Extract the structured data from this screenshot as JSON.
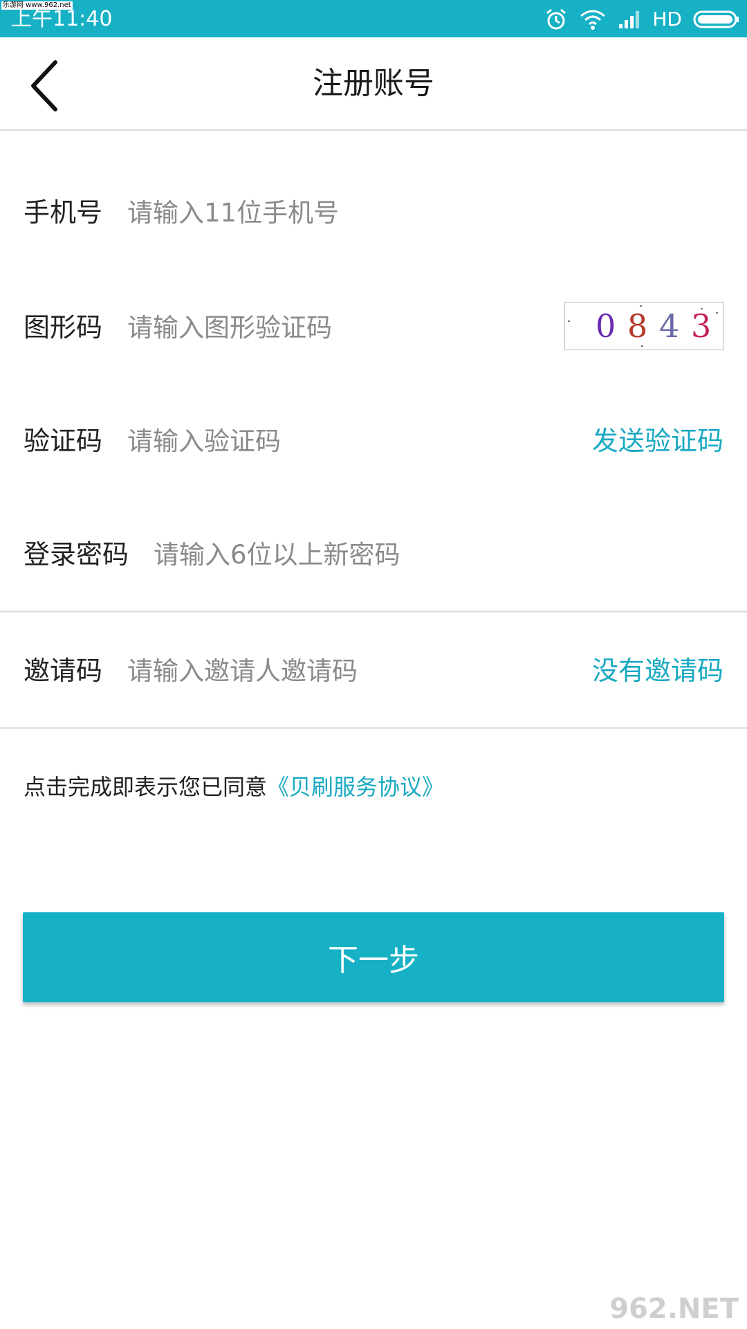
{
  "status_bar": {
    "time": "上午11:40",
    "network": "HD",
    "watermark": "乐游网 www.962.net",
    "icons": [
      "alarm-icon",
      "wifi-icon",
      "signal-icon",
      "battery-icon"
    ]
  },
  "header": {
    "title": "注册账号",
    "back_icon": "chevron-left-icon"
  },
  "form": {
    "phone": {
      "label": "手机号",
      "placeholder": "请输入11位手机号",
      "value": ""
    },
    "captcha": {
      "label": "图形码",
      "placeholder": "请输入图形验证码",
      "value": "",
      "image_text": [
        "0",
        "8",
        "4",
        "3"
      ],
      "image_colors": [
        "#6a2bb3",
        "#b33a2b",
        "#6a6aa8",
        "#c2245a"
      ]
    },
    "sms_code": {
      "label": "验证码",
      "placeholder": "请输入验证码",
      "value": "",
      "action": "发送验证码"
    },
    "password": {
      "label": "登录密码",
      "placeholder": "请输入6位以上新密码",
      "value": ""
    },
    "invite": {
      "label": "邀请码",
      "placeholder": "请输入邀请人邀请码",
      "value": "",
      "action": "没有邀请码"
    }
  },
  "agreement": {
    "text": "点击完成即表示您已同意",
    "link": "《贝刷服务协议》"
  },
  "next_button": {
    "label": "下一步"
  },
  "colors": {
    "accent": "#17b1c6",
    "link": "#19a9c2",
    "placeholder": "#8a8a8a"
  },
  "watermark_bottom": "962.NET"
}
